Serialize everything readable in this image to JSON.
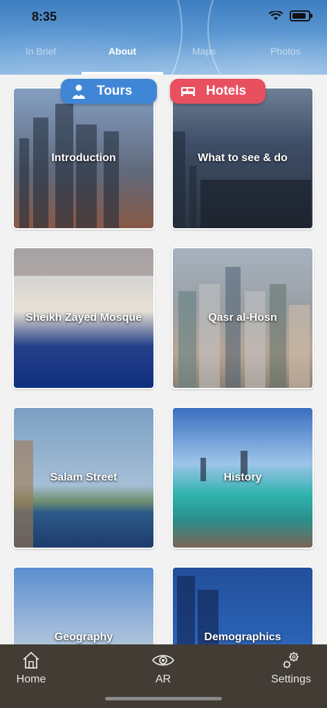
{
  "status": {
    "time": "8:35"
  },
  "tabs": [
    {
      "label": "In Brief"
    },
    {
      "label": "About"
    },
    {
      "label": "Maps"
    },
    {
      "label": "Photos"
    }
  ],
  "actions": {
    "tours_label": "Tours",
    "hotels_label": "Hotels"
  },
  "cards": [
    {
      "label": "Introduction"
    },
    {
      "label": "What to see & do"
    },
    {
      "label": "Sheikh Zayed Mosque"
    },
    {
      "label": "Qasr al-Hosn"
    },
    {
      "label": "Salam Street"
    },
    {
      "label": "History"
    },
    {
      "label": "Geography"
    },
    {
      "label": "Demographics"
    }
  ],
  "bottom_nav": [
    {
      "label": "Home",
      "icon": "home-icon"
    },
    {
      "label": "AR",
      "icon": "eye-icon"
    },
    {
      "label": "Settings",
      "icon": "gears-icon"
    }
  ],
  "colors": {
    "tours": "#3f86d6",
    "hotels": "#e8505f",
    "nav_bg": "#3a342c"
  }
}
